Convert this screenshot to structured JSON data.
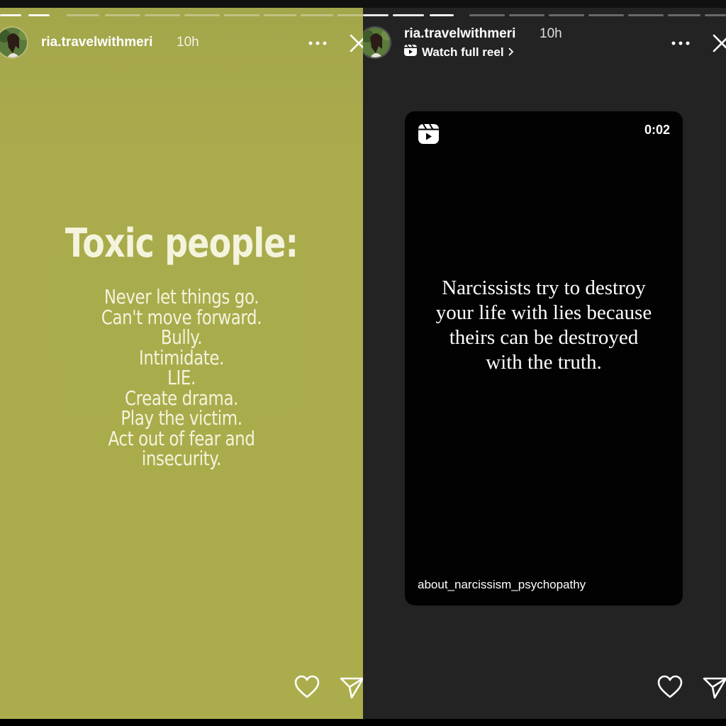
{
  "left_story": {
    "username": "ria.travelwithmeri",
    "time_ago": "10h",
    "quote": {
      "title": "Toxic people:",
      "lines": [
        "Never let things go.",
        "Can't move forward.",
        "Bully.",
        "Intimidate.",
        "LIE.",
        "Create drama.",
        "Play the victim.",
        "Act out of fear and",
        "insecurity."
      ]
    }
  },
  "right_story": {
    "username": "ria.travelwithmeri",
    "time_ago": "10h",
    "watch_link": "Watch full reel",
    "reel": {
      "duration": "0:02",
      "quote_lines": [
        "Narcissists try to destroy",
        "your life with lies because",
        "theirs can be destroyed",
        "with the truth."
      ],
      "author": "about_narcissism_psychopathy"
    }
  },
  "icons": {
    "more": "more-horizontal-icon",
    "close": "close-icon",
    "like": "heart-icon",
    "share": "send-icon",
    "reel": "reels-icon"
  },
  "colors": {
    "left_background": "#abad4c",
    "right_background": "#232323",
    "reel_card": "#020202"
  }
}
